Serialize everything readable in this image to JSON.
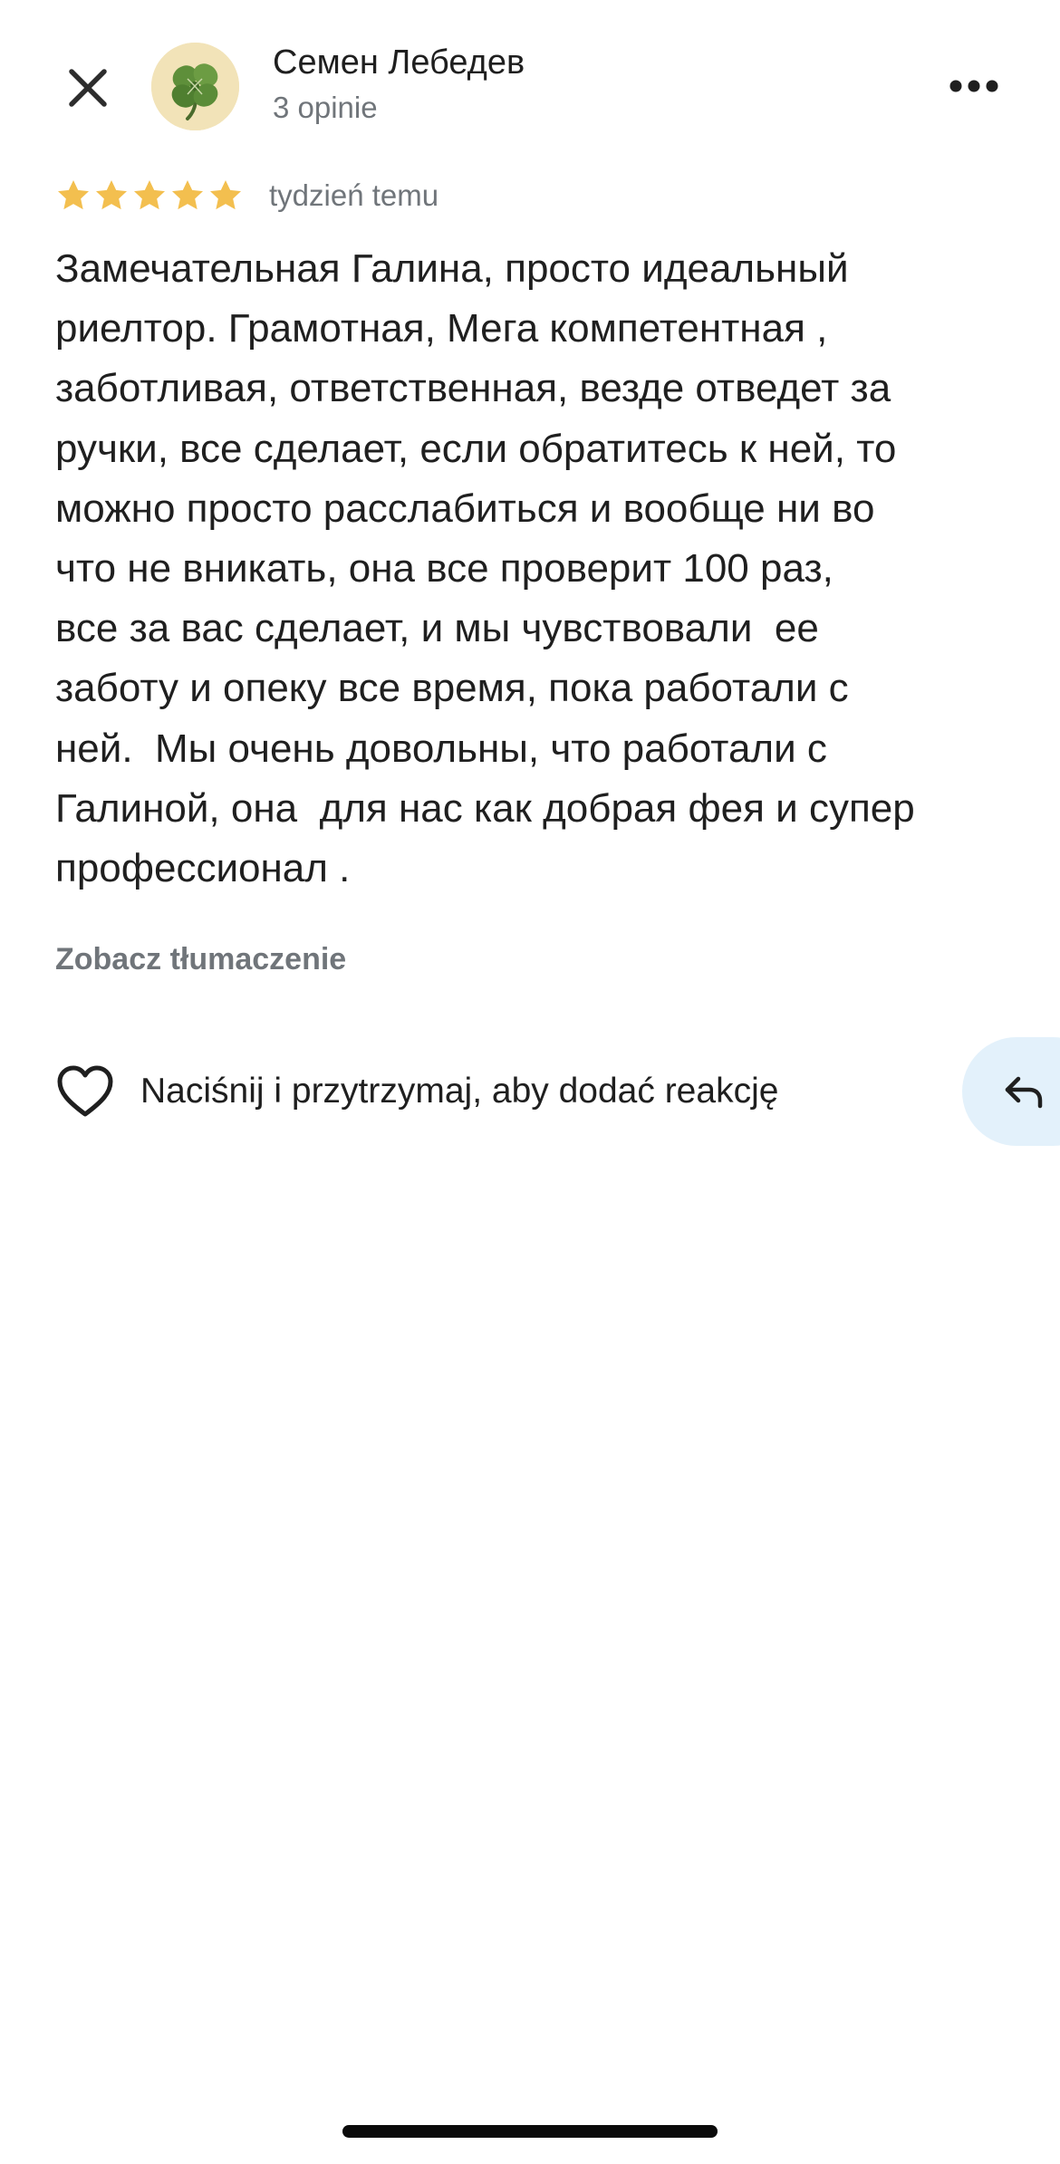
{
  "header": {
    "close_icon": "close-icon",
    "author_name": "Семен Лебедев",
    "author_meta": "3 opinie",
    "avatar_icon": "four-leaf-clover",
    "more_icon": "more-horizontal-icon"
  },
  "review": {
    "rating": 5,
    "rating_max": 5,
    "star_color": "#f3bf4f",
    "date": "tydzień temu",
    "text": "Замечательная Галина, просто идеальный\nриелтор. Грамотная, Мега компетентная ,\nзаботливая, ответственная, везде отведет за\nручки, все сделает, если обратитесь к ней, то\nможно просто расслабиться и вообще ни во\nчто не вникать, она все проверит 100 раз,\nвсе за вас сделает, и мы чувствовали  ее\nзаботу и опеку все время, пока работали с\nней.  Мы очень довольны, что работали с\nГалиной, она  для нас как добрая фея и супер\nпрофессионал .",
    "translate_label": "Zobacz tłumaczenie"
  },
  "reaction": {
    "heart_icon": "heart-outline-icon",
    "label": "Naciśnij i przytrzymaj, aby dodać reakcję",
    "reply_icon": "reply-arrow-icon",
    "reply_bg": "#e3f1fb"
  }
}
